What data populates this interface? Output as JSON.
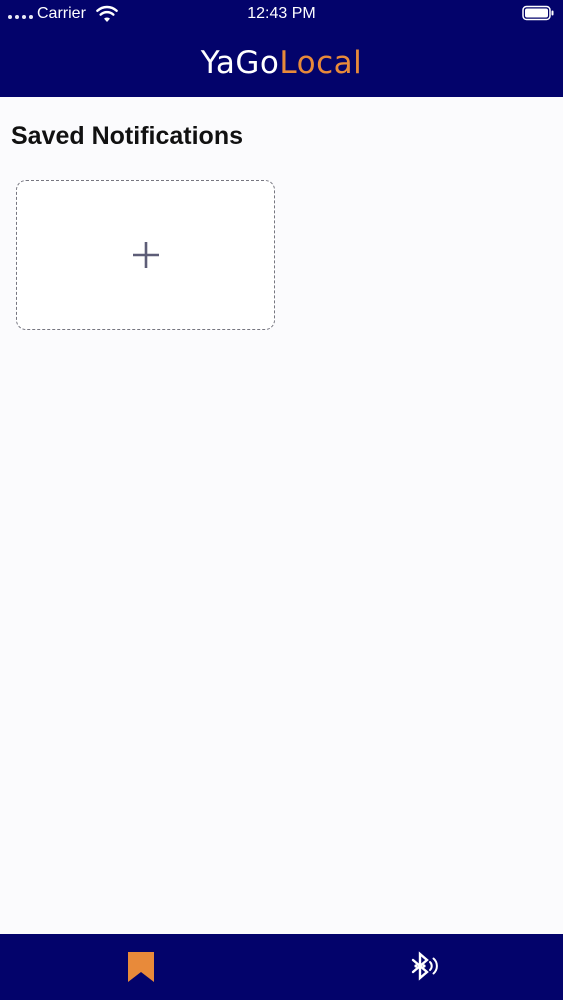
{
  "status_bar": {
    "carrier": "Carrier",
    "time": "12:43 PM",
    "wifi_icon": "wifi-icon",
    "battery_icon": "battery-icon"
  },
  "header": {
    "brand_part_1": "YaGo",
    "brand_part_2": "Local",
    "colors": {
      "background": "#03036b",
      "brand_part_1": "#ffffff",
      "brand_part_2": "#e88a3a"
    }
  },
  "main": {
    "title": "Saved Notifications",
    "add_card": {
      "icon": "plus-icon"
    }
  },
  "tab_bar": {
    "tabs": [
      {
        "icon": "bookmark-icon",
        "active": true,
        "color": "#e88a3a"
      },
      {
        "icon": "bluetooth-audio-icon",
        "active": false,
        "color": "#ffffff"
      }
    ]
  }
}
